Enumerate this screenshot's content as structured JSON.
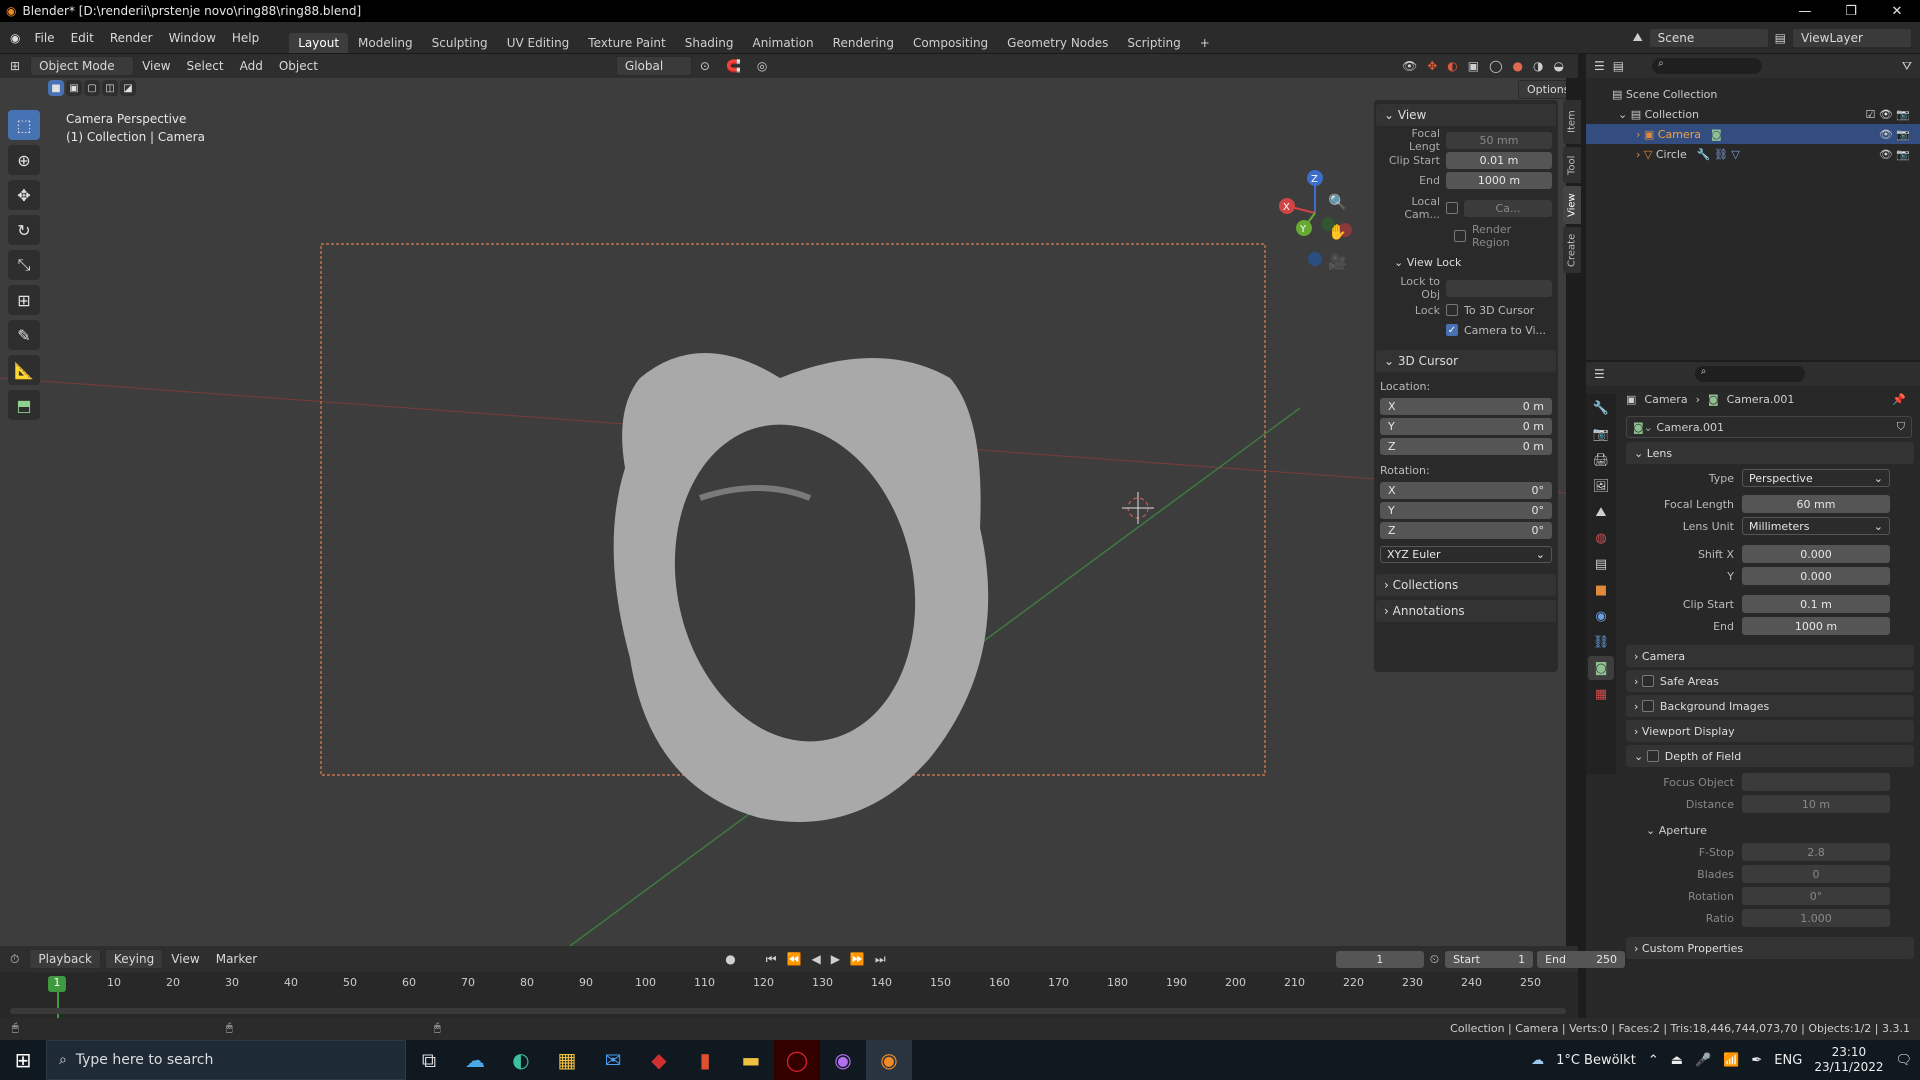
{
  "titlebar": {
    "title": "Blender* [D:\\renderii\\prstenje novo\\ring88\\ring88.blend]",
    "min": "—",
    "max": "❐",
    "close": "✕"
  },
  "menus": [
    "File",
    "Edit",
    "Render",
    "Window",
    "Help"
  ],
  "workspaces": [
    "Layout",
    "Modeling",
    "Sculpting",
    "UV Editing",
    "Texture Paint",
    "Shading",
    "Animation",
    "Rendering",
    "Compositing",
    "Geometry Nodes",
    "Scripting"
  ],
  "add_tab": "+",
  "scene": {
    "name": "Scene",
    "viewlayer": "ViewLayer"
  },
  "header3d": {
    "mode": "Object Mode",
    "menus": [
      "View",
      "Select",
      "Add",
      "Object"
    ],
    "orientation": "Global",
    "options": "Options"
  },
  "viewport": {
    "line1": "Camera Perspective",
    "line2": "(1) Collection | Camera",
    "axes": [
      "Z",
      "Y",
      "X"
    ]
  },
  "npanel": {
    "tabs": [
      "Item",
      "Tool",
      "View",
      "Create"
    ],
    "view": {
      "title": "View",
      "focal_label": "Focal Lengt",
      "focal": "50 mm",
      "clip_start_label": "Clip Start",
      "clip_start": "0.01 m",
      "end_label": "End",
      "end": "1000 m",
      "local_cam_label": "Local Cam...",
      "local_cam": "Ca...",
      "render_region": "Render Region"
    },
    "view_lock": {
      "title": "View Lock",
      "lock_obj_label": "Lock to Obj",
      "lock_label": "Lock",
      "to_cursor": "To 3D Cursor",
      "camera_to_view": "Camera to Vi..."
    },
    "cursor": {
      "title": "3D Cursor",
      "location": "Location:",
      "rotation": "Rotation:",
      "x": "X",
      "y": "Y",
      "z": "Z",
      "lx": "0 m",
      "ly": "0 m",
      "lz": "0 m",
      "rx": "0°",
      "ry": "0°",
      "rz": "0°",
      "euler": "XYZ Euler"
    },
    "collections": "Collections",
    "annotations": "Annotations"
  },
  "outliner": {
    "scene_collection": "Scene Collection",
    "collection": "Collection",
    "camera": "Camera",
    "circle": "Circle"
  },
  "props": {
    "breadcrumb_obj": "Camera",
    "breadcrumb_data": "Camera.001",
    "data_name": "Camera.001",
    "lens": "Lens",
    "type_label": "Type",
    "type": "Perspective",
    "focal_label": "Focal Length",
    "focal": "60 mm",
    "unit_label": "Lens Unit",
    "unit": "Millimeters",
    "shiftx_label": "Shift X",
    "shiftx": "0.000",
    "y_label": "Y",
    "shifty": "0.000",
    "clip_label": "Clip Start",
    "clip": "0.1 m",
    "end_label": "End",
    "end": "1000 m",
    "camera": "Camera",
    "safe": "Safe Areas",
    "bg": "Background Images",
    "vpd": "Viewport Display",
    "dof": "Depth of Field",
    "focus_label": "Focus Object",
    "distance_label": "Distance",
    "distance": "10 m",
    "aperture": "Aperture",
    "fstop_label": "F-Stop",
    "fstop": "2.8",
    "blades_label": "Blades",
    "blades": "0",
    "rot_label": "Rotation",
    "rot": "0°",
    "ratio_label": "Ratio",
    "ratio": "1.000",
    "custom": "Custom Properties"
  },
  "timeline": {
    "menus": [
      "Playback",
      "Keying",
      "View",
      "Marker"
    ],
    "frame": "1",
    "start_label": "Start",
    "start": "1",
    "end_label": "End",
    "end": "250",
    "ticks": [
      "0",
      "10",
      "20",
      "30",
      "40",
      "50",
      "60",
      "70",
      "80",
      "90",
      "100",
      "110",
      "120",
      "130",
      "140",
      "150",
      "160",
      "170",
      "180",
      "190",
      "200",
      "210",
      "220",
      "230",
      "240",
      "250"
    ],
    "current": "1"
  },
  "status": {
    "right": "Collection | Camera | Verts:0 | Faces:2 | Tris:18,446,744,073,70 | Objects:1/2 | 3.3.1"
  },
  "taskbar": {
    "search": "Type here to search",
    "weather": "1°C  Bewölkt",
    "lang": "ENG",
    "time": "23:10",
    "date": "23/11/2022"
  }
}
